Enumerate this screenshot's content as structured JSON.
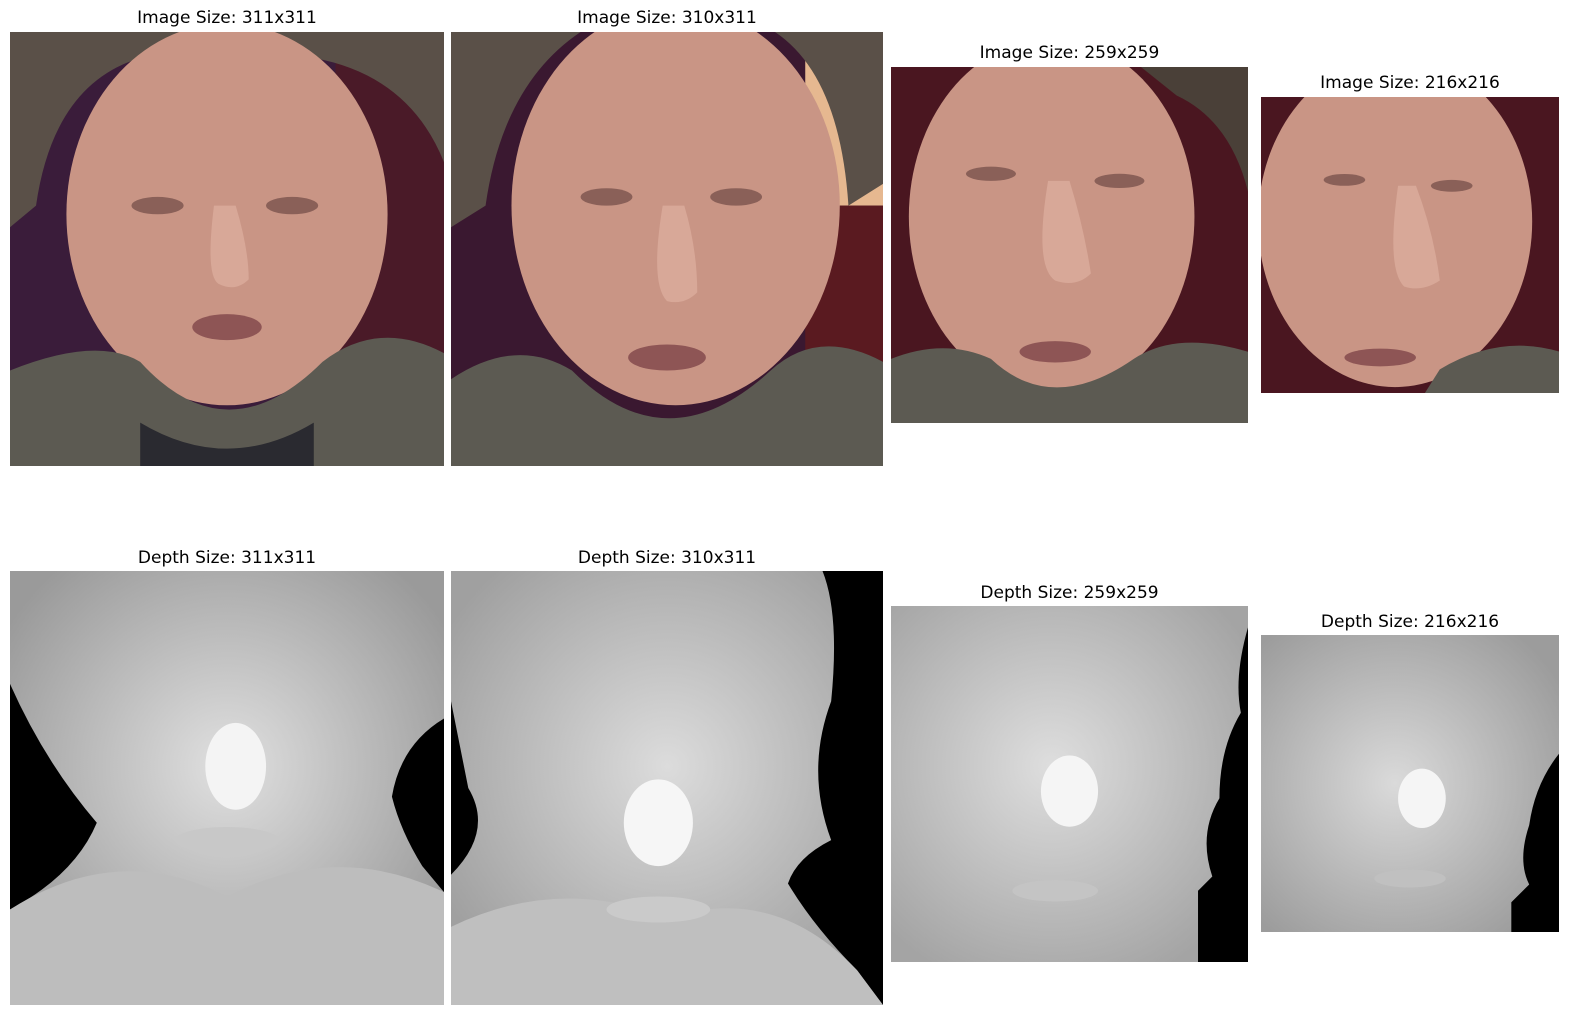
{
  "figure": {
    "image_titles": [
      "Image Size: 311x311",
      "Image Size: 310x311",
      "Image Size: 259x259",
      "Image Size: 216x216"
    ],
    "depth_titles": [
      "Depth Size: 311x311",
      "Depth Size: 310x311",
      "Depth Size: 259x259",
      "Depth Size: 216x216"
    ]
  },
  "colors": {
    "skin": "#c99585",
    "hair": "#5a5048",
    "shirt": "#5c5a52",
    "background_dark": "#3a1424",
    "depth_background": "#000000",
    "depth_face": "#d8d8d8"
  },
  "subject": "man-face-photo"
}
